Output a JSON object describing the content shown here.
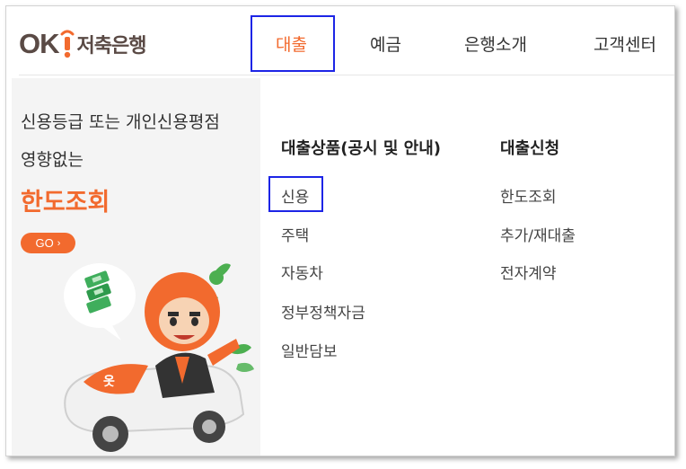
{
  "header": {
    "logo_ok": "OK",
    "logo_bank": "저축은행",
    "nav": [
      {
        "label": "대출"
      },
      {
        "label": "예금"
      },
      {
        "label": "은행소개"
      },
      {
        "label": "고객센터"
      }
    ]
  },
  "promo": {
    "line1": "신용등급 또는 개인신용평점",
    "line2": "영향없는",
    "title": "한도조회",
    "go_label": "GO",
    "mascot_badge": "옷"
  },
  "menu": {
    "col1": {
      "title": "대출상품(공시 및 안내)",
      "items": [
        {
          "label": "신용"
        },
        {
          "label": "주택"
        },
        {
          "label": "자동차"
        },
        {
          "label": "정부정책자금"
        },
        {
          "label": "일반담보"
        }
      ]
    },
    "col2": {
      "title": "대출신청",
      "items": [
        {
          "label": "한도조회"
        },
        {
          "label": "추가/재대출"
        },
        {
          "label": "전자계약"
        }
      ]
    }
  },
  "colors": {
    "accent": "#f26a2e",
    "logo": "#5a4a45",
    "highlight_box": "#1d25e6",
    "promo_bg": "#f4f4f4"
  }
}
